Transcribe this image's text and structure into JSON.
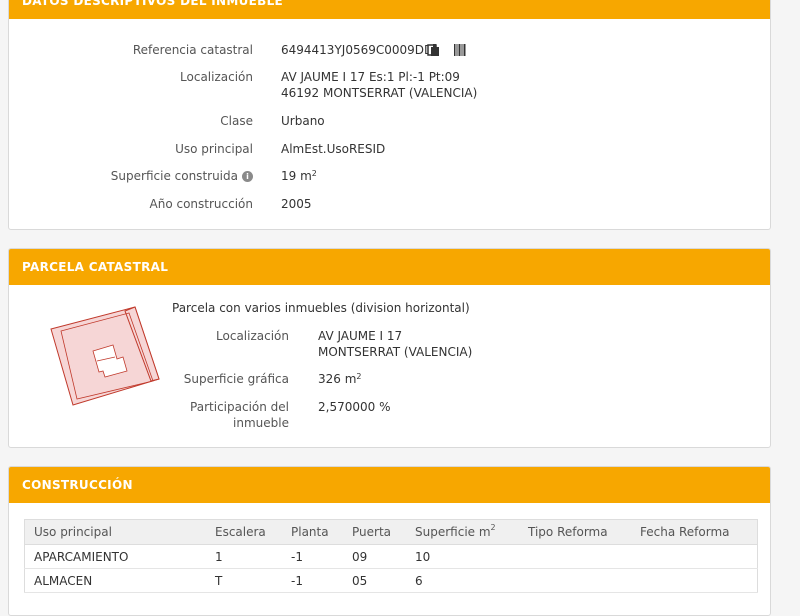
{
  "datos": {
    "title": "DATOS DESCRIPTIVOS DEL INMUEBLE",
    "referencia_label": "Referencia catastral",
    "referencia_value": "6494413YJ0569C0009DD",
    "localizacion_label": "Localización",
    "localizacion_line1": "AV JAUME I 17 Es:1 Pl:-1 Pt:09",
    "localizacion_line2": "46192 MONTSERRAT (VALENCIA)",
    "clase_label": "Clase",
    "clase_value": "Urbano",
    "uso_label": "Uso principal",
    "uso_value": "AlmEst.UsoRESID",
    "superficie_label": "Superficie construida",
    "superficie_value": "19 m",
    "superficie_exp": "2",
    "anio_label": "Año construcción",
    "anio_value": "2005"
  },
  "parcela": {
    "title": "PARCELA CATASTRAL",
    "descripcion": "Parcela con varios inmuebles (division horizontal)",
    "localizacion_label": "Localización",
    "localizacion_line1": "AV JAUME I 17",
    "localizacion_line2": "MONTSERRAT (VALENCIA)",
    "superficie_label": "Superficie gráfica",
    "superficie_value": "326 m",
    "superficie_exp": "2",
    "participacion_label_1": "Participación del",
    "participacion_label_2": "inmueble",
    "participacion_value": "2,570000 %"
  },
  "construccion": {
    "title": "CONSTRUCCIÓN",
    "headers": [
      "Uso principal",
      "Escalera",
      "Planta",
      "Puerta",
      "Superficie m",
      "Tipo Reforma",
      "Fecha Reforma"
    ],
    "superficie_header_exp": "2",
    "rows": [
      [
        "APARCAMIENTO",
        "1",
        "-1",
        "09",
        "10",
        "",
        ""
      ],
      [
        "ALMACEN",
        "T",
        "-1",
        "05",
        "6",
        "",
        ""
      ]
    ]
  },
  "colors": {
    "accent": "#f7a700",
    "parcel_fill": "#f6d6d6",
    "parcel_stroke": "#c0392b"
  },
  "icons": [
    "copy-icon",
    "barcode-icon",
    "info-icon"
  ]
}
